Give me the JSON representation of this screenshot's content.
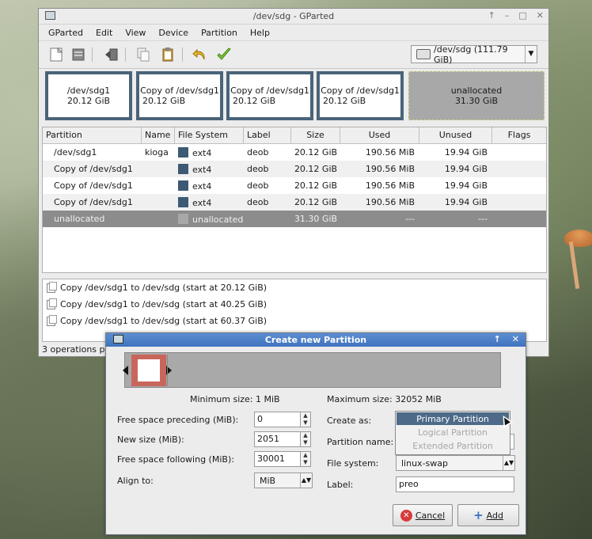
{
  "window": {
    "title": "/dev/sdg - GParted",
    "controls": [
      "↑",
      "–",
      "□",
      "✕"
    ]
  },
  "menu": [
    "GParted",
    "Edit",
    "View",
    "Device",
    "Partition",
    "Help"
  ],
  "toolbar": {
    "icons": [
      "new-icon",
      "delete-icon",
      "resize-icon",
      "copy-icon",
      "paste-icon",
      "undo-icon",
      "apply-icon"
    ]
  },
  "device_selector": {
    "value": "/dev/sdg  (111.79 GiB)"
  },
  "partition_map": [
    {
      "line1": "/dev/sdg1",
      "line2": "20.12 GiB"
    },
    {
      "line1": "Copy of /dev/sdg1",
      "line2": "20.12 GiB"
    },
    {
      "line1": "Copy of /dev/sdg1",
      "line2": "20.12 GiB"
    },
    {
      "line1": "Copy of /dev/sdg1",
      "line2": "20.12 GiB"
    },
    {
      "line1": "unallocated",
      "line2": "31.30 GiB"
    }
  ],
  "table": {
    "headers": [
      "Partition",
      "Name",
      "File System",
      "Label",
      "Size",
      "Used",
      "Unused",
      "Flags"
    ],
    "rows": [
      {
        "partition": "/dev/sdg1",
        "name": "kioga",
        "fs": "ext4",
        "label": "deob",
        "size": "20.12 GiB",
        "used": "190.56 MiB",
        "unused": "19.94 GiB",
        "flags": ""
      },
      {
        "partition": "Copy of /dev/sdg1",
        "name": "",
        "fs": "ext4",
        "label": "deob",
        "size": "20.12 GiB",
        "used": "190.56 MiB",
        "unused": "19.94 GiB",
        "flags": ""
      },
      {
        "partition": "Copy of /dev/sdg1",
        "name": "",
        "fs": "ext4",
        "label": "deob",
        "size": "20.12 GiB",
        "used": "190.56 MiB",
        "unused": "19.94 GiB",
        "flags": ""
      },
      {
        "partition": "Copy of /dev/sdg1",
        "name": "",
        "fs": "ext4",
        "label": "deob",
        "size": "20.12 GiB",
        "used": "190.56 MiB",
        "unused": "19.94 GiB",
        "flags": ""
      },
      {
        "partition": "unallocated",
        "name": "",
        "fs": "unallocated",
        "label": "",
        "size": "31.30 GiB",
        "used": "---",
        "unused": "---",
        "flags": ""
      }
    ]
  },
  "operations": [
    "Copy /dev/sdg1 to /dev/sdg (start at 20.12 GiB)",
    "Copy /dev/sdg1 to /dev/sdg (start at 40.25 GiB)",
    "Copy /dev/sdg1 to /dev/sdg (start at 60.37 GiB)"
  ],
  "status": "3 operations p",
  "dialog": {
    "title": "Create new Partition",
    "controls": [
      "↑",
      "✕"
    ],
    "min_size": "Minimum size: 1 MiB",
    "max_size": "Maximum size: 32052 MiB",
    "free_preceding_label": "Free space preceding (MiB):",
    "free_preceding_value": "0",
    "new_size_label": "New size (MiB):",
    "new_size_value": "2051",
    "free_following_label": "Free space following (MiB):",
    "free_following_value": "30001",
    "align_label": "Align to:",
    "align_value": "MiB",
    "create_as_label": "Create as:",
    "partition_name_label": "Partition name:",
    "file_system_label": "File system:",
    "file_system_value": "linux-swap",
    "label_label": "Label:",
    "label_value": "preo",
    "create_as_options": [
      "Primary Partition",
      "Logical Partition",
      "Extended Partition"
    ],
    "cancel_label": "Cancel",
    "add_label": "Add"
  }
}
